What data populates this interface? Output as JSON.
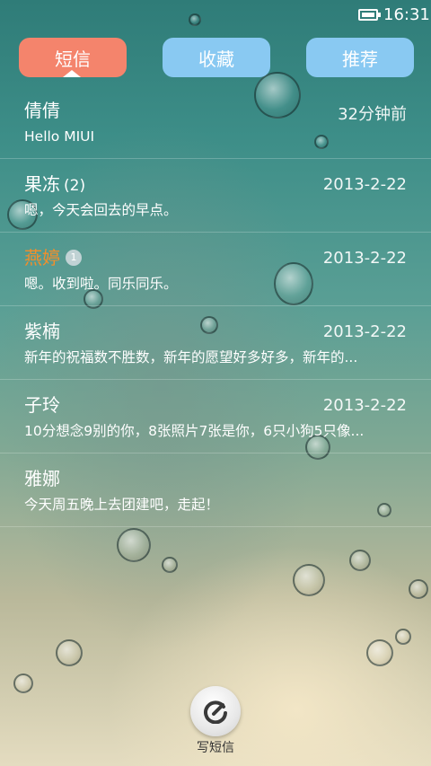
{
  "status_bar": {
    "time": "16:31",
    "battery_icon": "battery-icon"
  },
  "tabs": [
    {
      "label": "短信",
      "active": true
    },
    {
      "label": "收藏",
      "active": false
    },
    {
      "label": "推荐",
      "active": false
    }
  ],
  "conversations": [
    {
      "name": "倩倩",
      "count": "",
      "badge": "",
      "time": "32分钟前",
      "preview": "Hello MIUI",
      "unread": false
    },
    {
      "name": "果冻",
      "count": "(2)",
      "badge": "",
      "time": "2013-2-22",
      "preview": "嗯，今天会回去的早点。",
      "unread": false
    },
    {
      "name": "燕婷",
      "count": "",
      "badge": "1",
      "time": "2013-2-22",
      "preview": "嗯。收到啦。同乐同乐。",
      "unread": true
    },
    {
      "name": "紫楠",
      "count": "",
      "badge": "",
      "time": "2013-2-22",
      "preview": "新年的祝福数不胜数，新年的愿望好多好多，新年的...",
      "unread": false
    },
    {
      "name": "子玲",
      "count": "",
      "badge": "",
      "time": "2013-2-22",
      "preview": "10分想念9别的你，8张照片7张是你，6只小狗5只像...",
      "unread": false
    },
    {
      "name": "雅娜",
      "count": "",
      "badge": "",
      "time": "",
      "preview": "今天周五晚上去团建吧，走起！",
      "unread": false
    }
  ],
  "compose": {
    "label": "写短信",
    "icon": "compose-icon"
  },
  "colors": {
    "active_tab": "#f4846c",
    "inactive_tab": "#89c9f2",
    "unread_name": "#f38f2a"
  }
}
